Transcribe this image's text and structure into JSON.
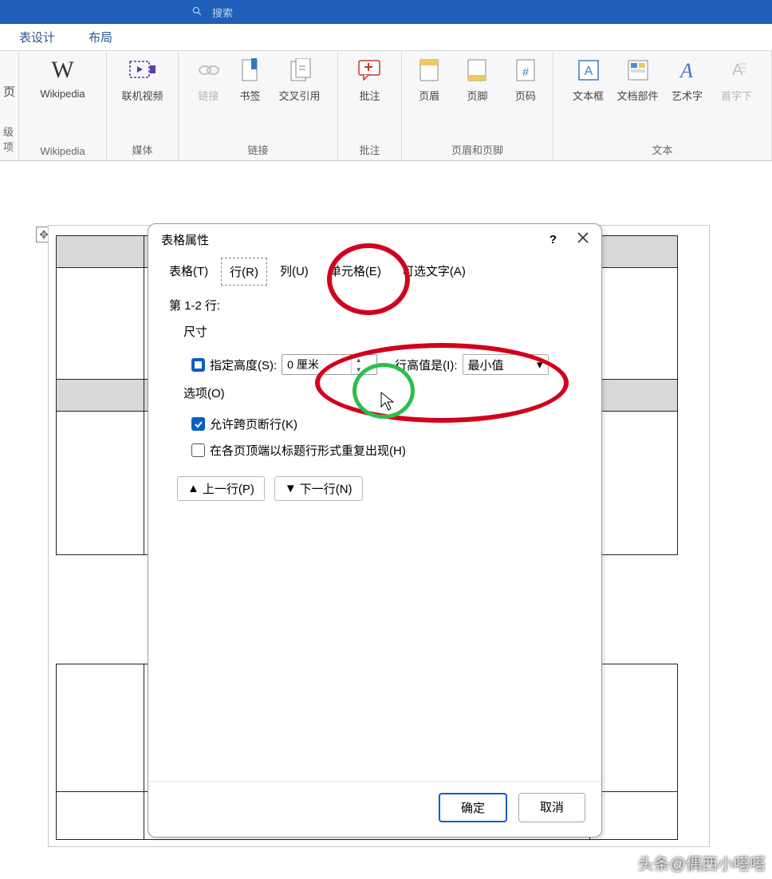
{
  "titlebar": {
    "search_placeholder": "搜索"
  },
  "tabs": {
    "table_design": "表设计",
    "layout": "布局"
  },
  "ribbon": {
    "first_label": "级项",
    "partial": "页",
    "wikipedia": "Wikipedia",
    "online_video": "联机视频",
    "link": "链接",
    "bookmark": "书签",
    "cross_ref": "交叉引用",
    "comment": "批注",
    "header": "页眉",
    "footer": "页脚",
    "page_number": "页码",
    "text_box": "文本框",
    "quick_parts": "文档部件",
    "word_art": "艺术字",
    "drop_cap": "首字下",
    "group_media": "媒体",
    "group_links": "链接",
    "group_comment": "批注",
    "group_headerfooter": "页眉和页脚",
    "group_text": "文本"
  },
  "dialog": {
    "title": "表格属性",
    "tabs": {
      "table": "表格(T)",
      "row": "行(R)",
      "column": "列(U)",
      "cell": "单元格(E)",
      "alt": "可选文字(A)"
    },
    "rows_label": "第 1-2 行:",
    "size_label": "尺寸",
    "specify_height": "指定高度(S):",
    "height_value": "0 厘米",
    "height_is": "行高值是(I):",
    "height_select": "最小值",
    "options_label": "选项(O)",
    "allow_break": "允许跨页断行(K)",
    "repeat_header": "在各页顶端以标题行形式重复出现(H)",
    "prev_row": "上一行(P)",
    "next_row": "下一行(N)",
    "ok": "确定",
    "cancel": "取消"
  },
  "watermark": "头条@偶西小嗒嗒"
}
